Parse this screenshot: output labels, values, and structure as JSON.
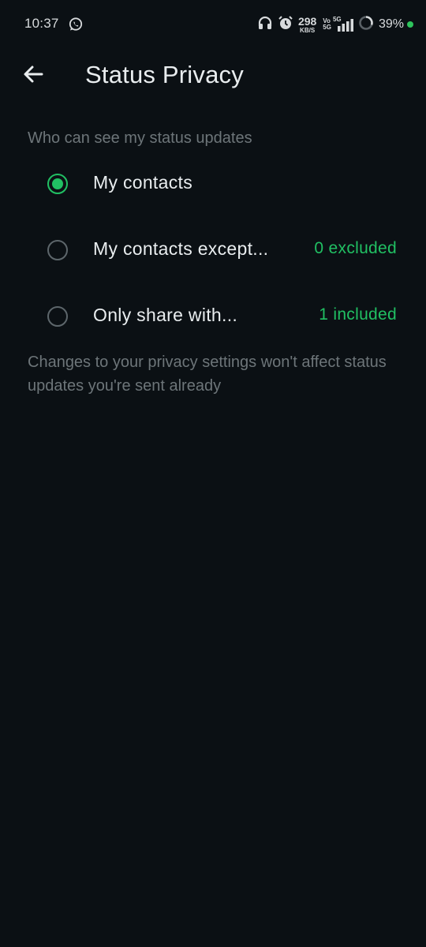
{
  "status_bar": {
    "time": "10:37",
    "speed_value": "298",
    "speed_unit": "KB/S",
    "vo_top": "Vo",
    "vo_bottom": "5G",
    "network_label": "5G",
    "battery": "39%",
    "icons": [
      "whatsapp-icon",
      "headphones-icon",
      "alarm-icon",
      "signal-icon",
      "battery-ring-icon",
      "charging-dot-icon"
    ],
    "accent_dot_color": "#2ec45c"
  },
  "app_bar": {
    "title": "Status Privacy",
    "back_icon": "arrow-left-icon"
  },
  "privacy": {
    "section_label": "Who can see my status updates",
    "options": [
      {
        "label": "My contacts",
        "meta": "",
        "selected": true
      },
      {
        "label": "My contacts except...",
        "meta": "0 excluded",
        "selected": false
      },
      {
        "label": "Only share with...",
        "meta": "1 included",
        "selected": false
      }
    ],
    "footnote": "Changes to your privacy settings won't affect status updates you're sent already"
  },
  "colors": {
    "background": "#0b1014",
    "accent": "#21c063",
    "text_primary": "#e9edef",
    "text_secondary": "#6d7579"
  }
}
